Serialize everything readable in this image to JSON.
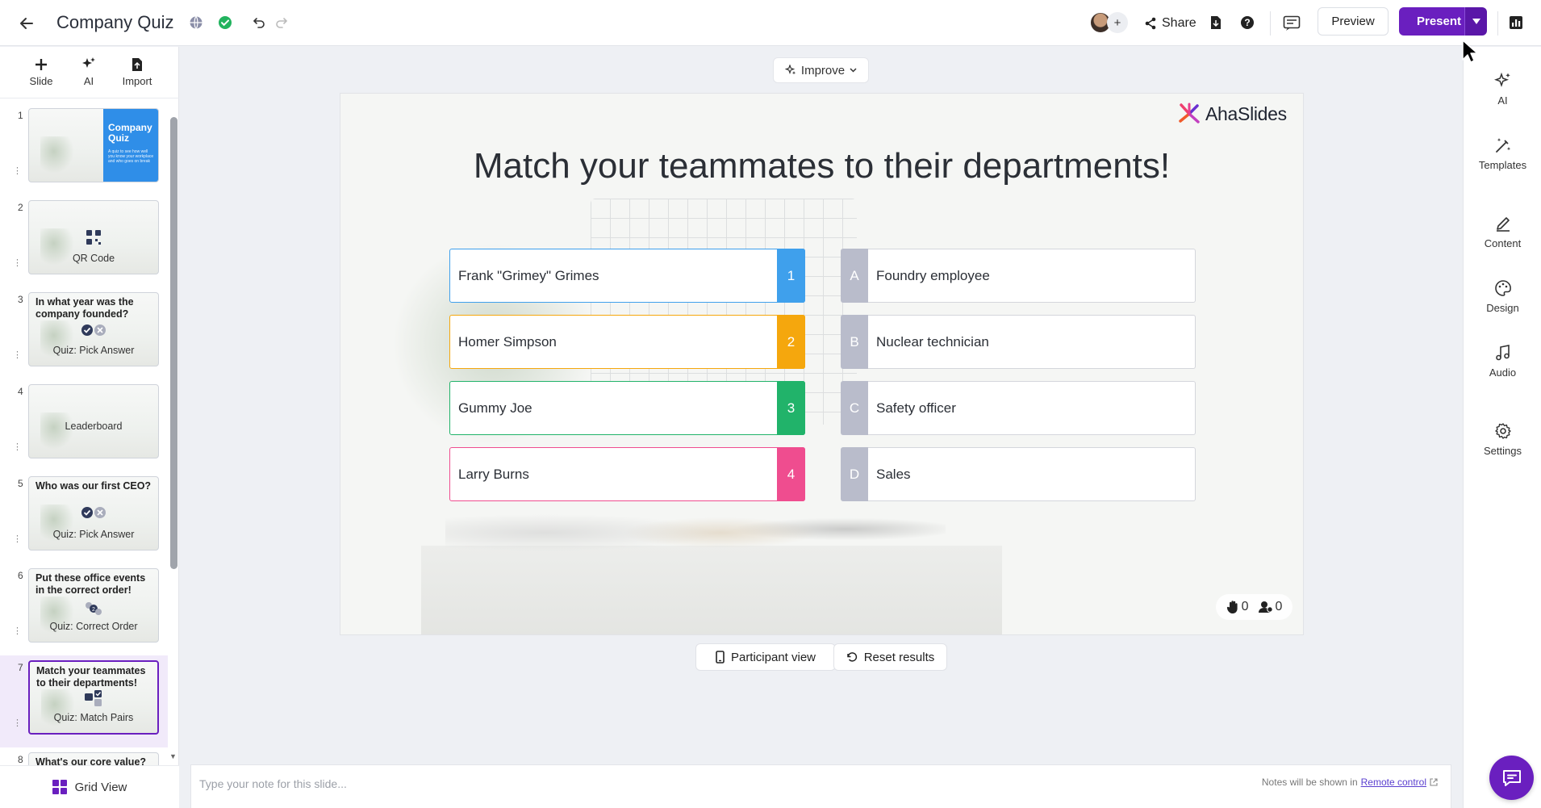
{
  "header": {
    "title": "Company Quiz",
    "share_label": "Share",
    "preview_label": "Preview",
    "present_label": "Present",
    "avatar_add": "+"
  },
  "left_tools": [
    {
      "label": "Slide",
      "icon": "plus-icon"
    },
    {
      "label": "AI",
      "icon": "sparkle-icon"
    },
    {
      "label": "Import",
      "icon": "import-icon"
    }
  ],
  "slides": [
    {
      "num": "1",
      "title": "Company Quiz",
      "subtitle": "A quiz to see how well you know your workplace and who goes on break",
      "type": ""
    },
    {
      "num": "2",
      "title": "",
      "type": "QR Code"
    },
    {
      "num": "3",
      "title": "In what year was the company founded?",
      "type": "Quiz: Pick Answer"
    },
    {
      "num": "4",
      "title": "",
      "type": "Leaderboard"
    },
    {
      "num": "5",
      "title": "Who was our first CEO?",
      "type": "Quiz: Pick Answer"
    },
    {
      "num": "6",
      "title": "Put these office events in the correct order!",
      "type": "Quiz: Correct Order"
    },
    {
      "num": "7",
      "title": "Match your teammates to their departments!",
      "type": "Quiz: Match Pairs"
    },
    {
      "num": "8",
      "title": "What's our core value?",
      "type": ""
    }
  ],
  "grid_view_label": "Grid View",
  "improve_label": "Improve",
  "slide": {
    "logo_text": "AhaSlides",
    "title": "Match your teammates to their departments!",
    "left_items": [
      {
        "label": "Frank \"Grimey\" Grimes",
        "num": "1",
        "color": "#3fa0ec"
      },
      {
        "label": "Homer Simpson",
        "num": "2",
        "color": "#f5a70d"
      },
      {
        "label": "Gummy Joe",
        "num": "3",
        "color": "#21b36a"
      },
      {
        "label": "Larry Burns",
        "num": "4",
        "color": "#ef4d8f"
      }
    ],
    "right_items": [
      {
        "letter": "A",
        "label": "Foundry employee"
      },
      {
        "letter": "B",
        "label": "Nuclear technician"
      },
      {
        "letter": "C",
        "label": "Safety officer"
      },
      {
        "letter": "D",
        "label": "Sales"
      }
    ],
    "raised_hands": "0",
    "participants": "0"
  },
  "participant_view_label": "Participant view",
  "reset_results_label": "Reset results",
  "notes": {
    "placeholder": "Type your note for this slide...",
    "hint_prefix": "Notes will be shown in",
    "hint_link": "Remote control"
  },
  "right_sidebar": [
    {
      "label": "AI",
      "icon": "sparkle-icon"
    },
    {
      "label": "Templates",
      "icon": "magic-wand-icon"
    },
    {
      "label": "Content",
      "icon": "pencil-icon"
    },
    {
      "label": "Design",
      "icon": "palette-icon"
    },
    {
      "label": "Audio",
      "icon": "music-note-icon"
    },
    {
      "label": "Settings",
      "icon": "gear-icon"
    }
  ],
  "colors": {
    "brand": "#6a1fbf",
    "letter_bg": "#b9bccb"
  }
}
